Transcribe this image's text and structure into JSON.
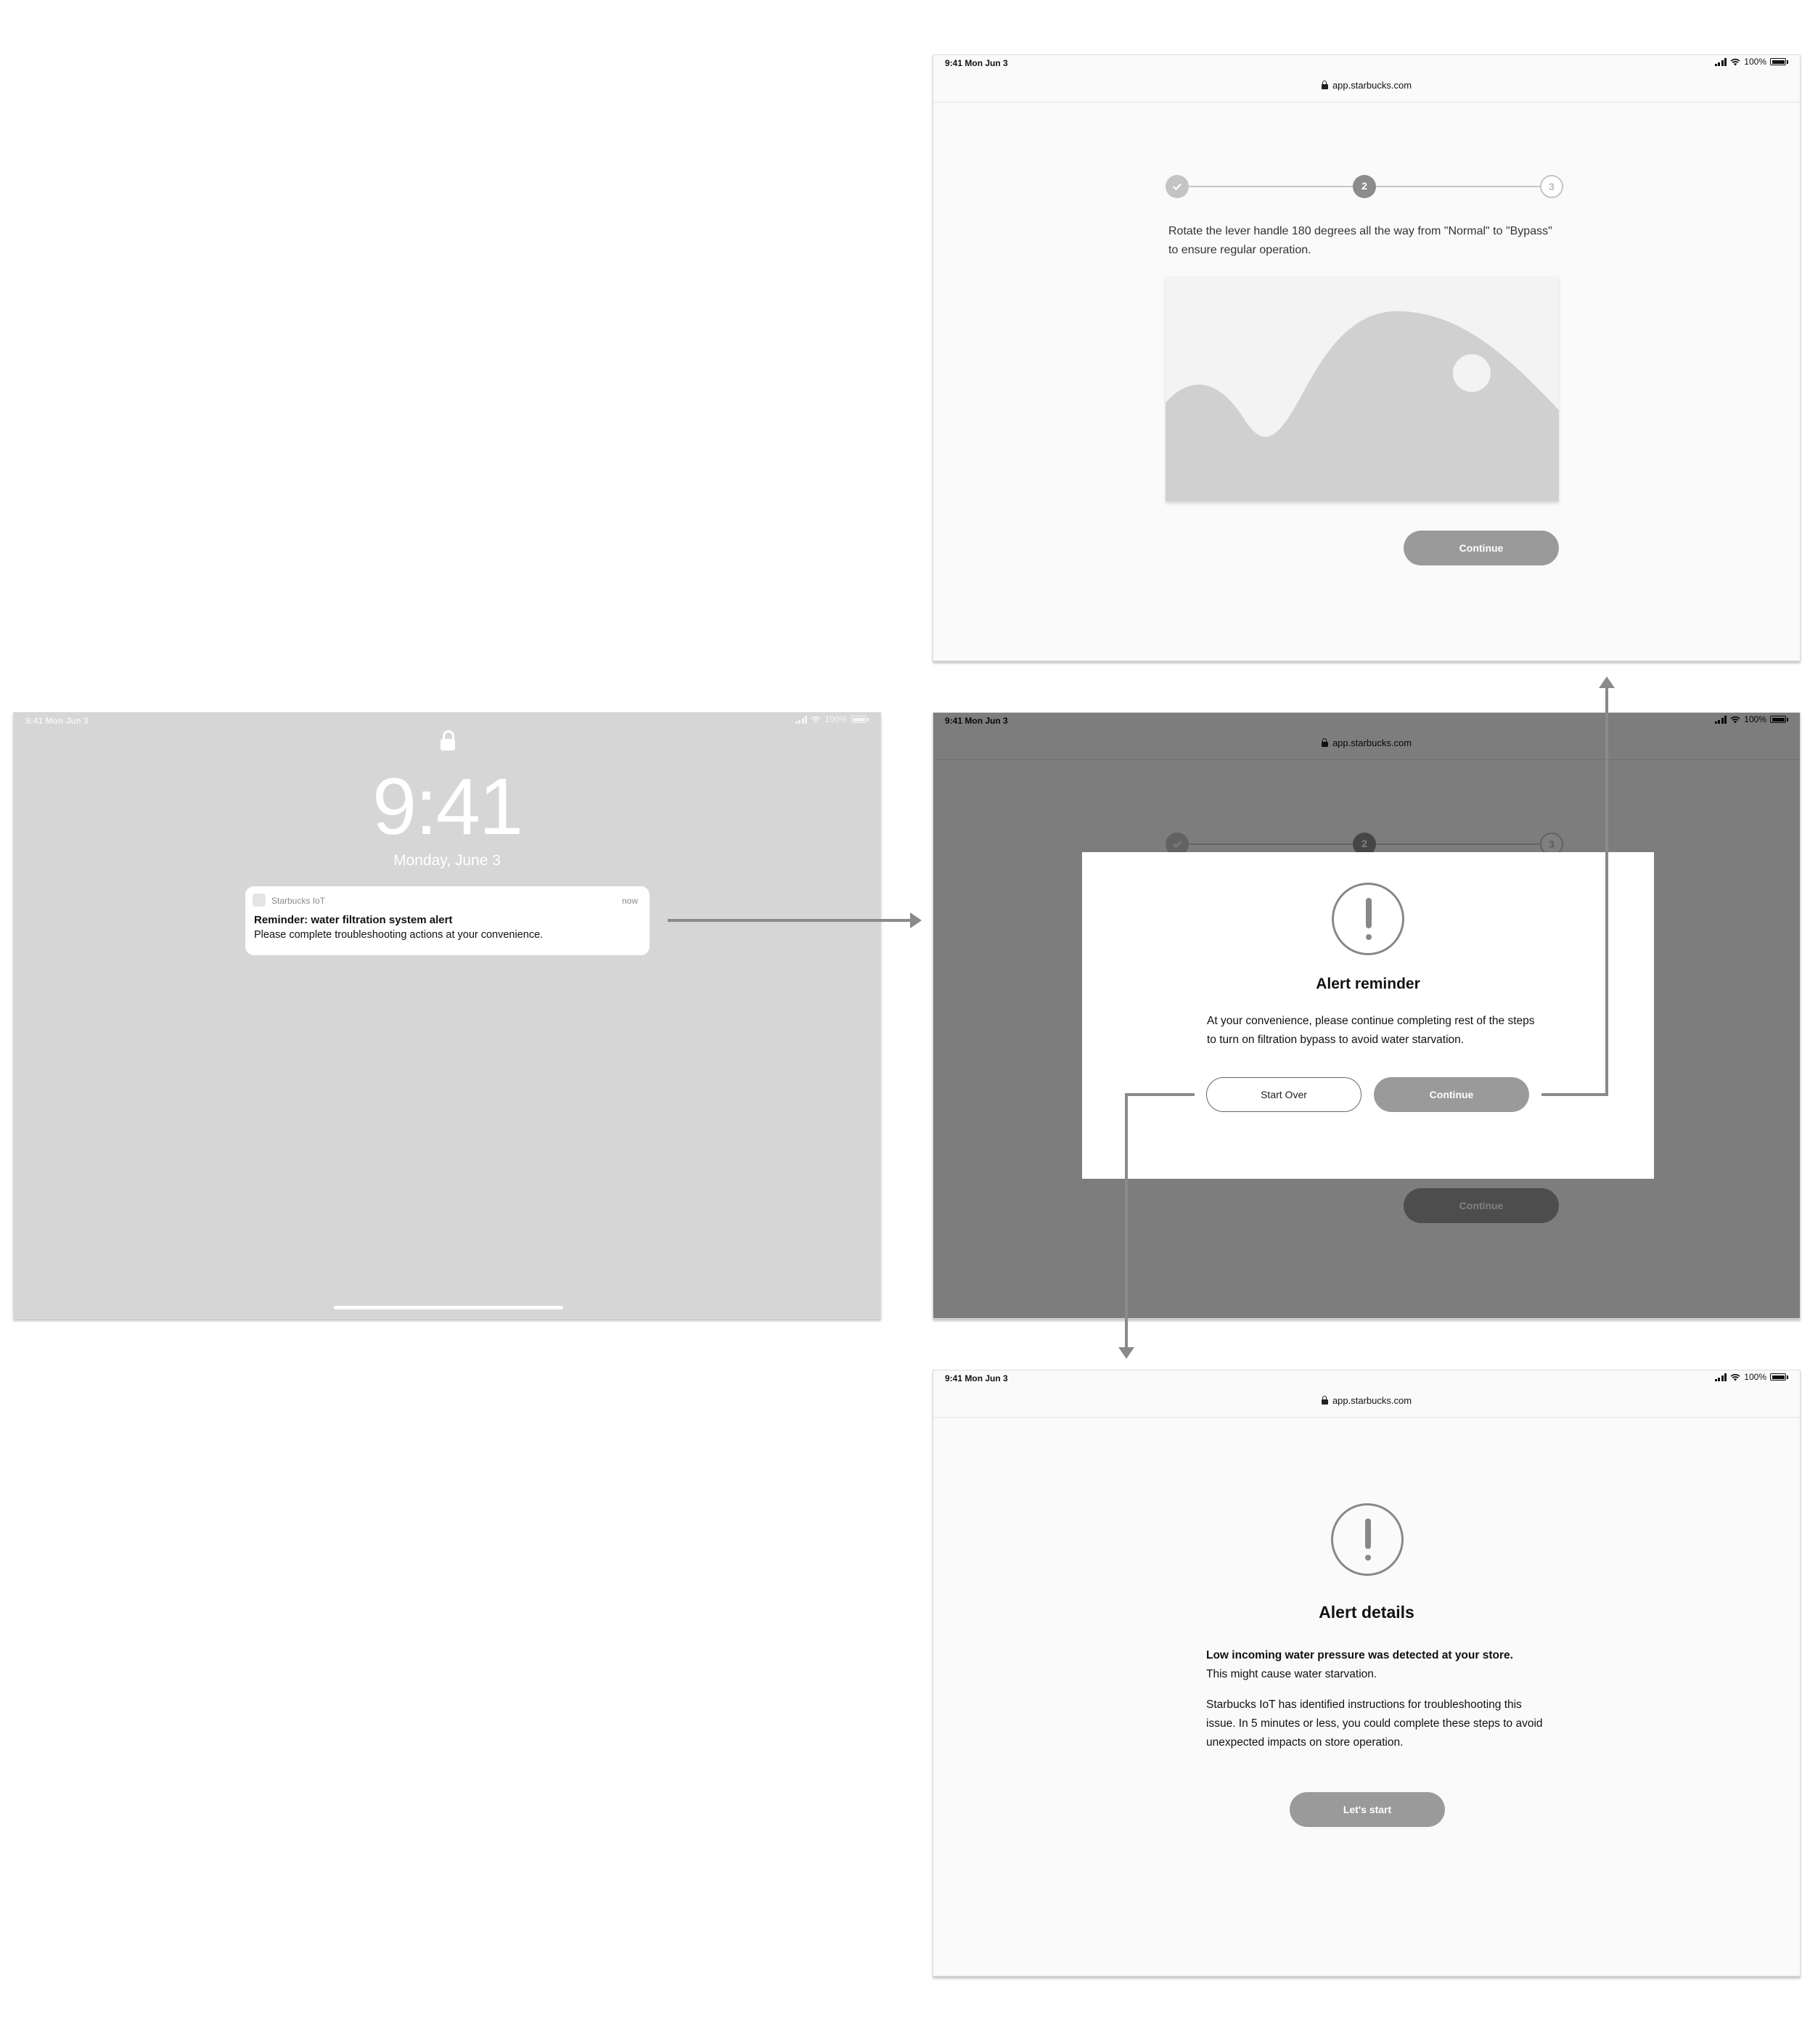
{
  "colors": {
    "lockscreen_bg": "#d6d6d6",
    "button_fill": "#9a9a9a",
    "icon_gray": "#888888",
    "connector": "#8a8a8a"
  },
  "status": {
    "time": "9:41",
    "date": "Mon Jun 3",
    "battery": "100%"
  },
  "lockscreen": {
    "clock": "9:41",
    "date": "Monday, June 3",
    "notification": {
      "app": "Starbucks IoT",
      "time": "now",
      "title": "Reminder: water filtration system alert",
      "body": "Please complete troubleshooting actions at your convenience."
    }
  },
  "browser": {
    "url": "app.starbucks.com"
  },
  "step_screen": {
    "steps": [
      "✓",
      "2",
      "3"
    ],
    "current_step": 2,
    "instruction": "Rotate the lever handle 180 degrees all the way from \"Normal\" to \"Bypass\" to ensure regular operation.",
    "continue_label": "Continue"
  },
  "reminder_modal": {
    "title": "Alert reminder",
    "body": "At your convenience, please continue completing rest of the steps to turn on filtration bypass to avoid water starvation.",
    "start_over_label": "Start Over",
    "continue_label": "Continue"
  },
  "details_screen": {
    "title": "Alert details",
    "lead_bold": "Low incoming water pressure was detected at your store.",
    "lead_rest": "This might cause water starvation.",
    "paragraph": "Starbucks IoT has identified instructions for troubleshooting this issue. In 5 minutes or less, you could complete these steps to avoid unexpected impacts on store operation.",
    "cta_label": "Let's start"
  }
}
